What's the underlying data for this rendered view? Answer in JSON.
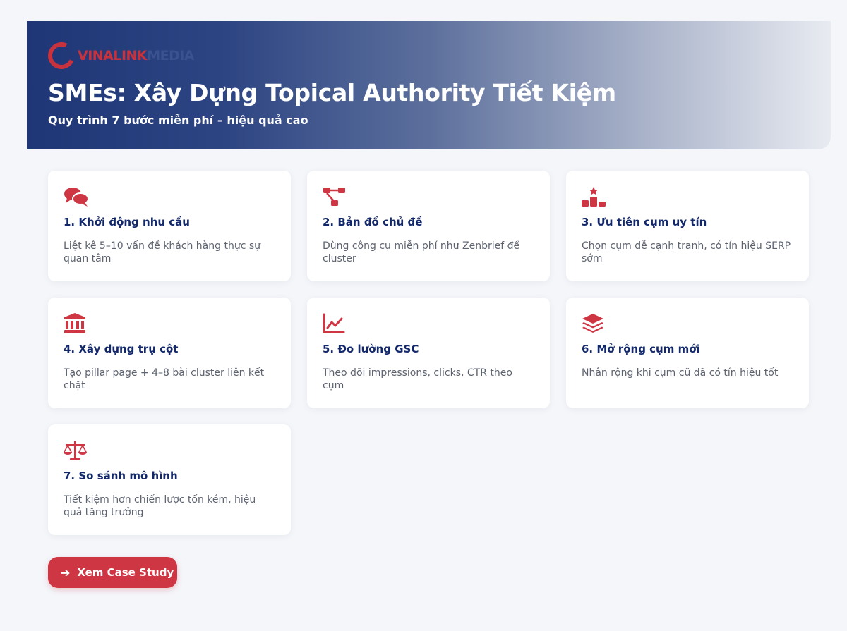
{
  "brand": {
    "logo_part1": "VINALINK",
    "logo_part2": "MEDIA"
  },
  "hero": {
    "title": "SMEs: Xây Dựng Topical Authority Tiết Kiệm",
    "subtitle": "Quy trình 7 bước miễn phí – hiệu quả cao"
  },
  "colors": {
    "accent": "#cf3644",
    "title": "#12286b",
    "hero_start": "#1f3676"
  },
  "steps": [
    {
      "icon": "chat-bubbles-icon",
      "title": "1. Khởi động nhu cầu",
      "desc": "Liệt kê 5–10 vấn đề khách hàng thực sự quan tâm"
    },
    {
      "icon": "sitemap-icon",
      "title": "2. Bản đồ chủ đề",
      "desc": "Dùng công cụ miễn phí như Zenbrief để cluster"
    },
    {
      "icon": "ranking-podium-icon",
      "title": "3. Ưu tiên cụm uy tín",
      "desc": "Chọn cụm dễ cạnh tranh, có tín hiệu SERP sớm"
    },
    {
      "icon": "pillar-building-icon",
      "title": "4. Xây dựng trụ cột",
      "desc": "Tạo pillar page + 4–8 bài cluster liên kết chặt"
    },
    {
      "icon": "line-chart-icon",
      "title": "5. Đo lường GSC",
      "desc": "Theo dõi impressions, clicks, CTR theo cụm"
    },
    {
      "icon": "layers-icon",
      "title": "6. Mở rộng cụm mới",
      "desc": "Nhân rộng khi cụm cũ đã có tín hiệu tốt"
    },
    {
      "icon": "balance-scale-icon",
      "title": "7. So sánh mô hình",
      "desc": "Tiết kiệm hơn chiến lược tốn kém, hiệu quả tăng trưởng"
    }
  ],
  "cta": {
    "icon": "arrow-right-icon",
    "label": "Xem Case Study"
  }
}
